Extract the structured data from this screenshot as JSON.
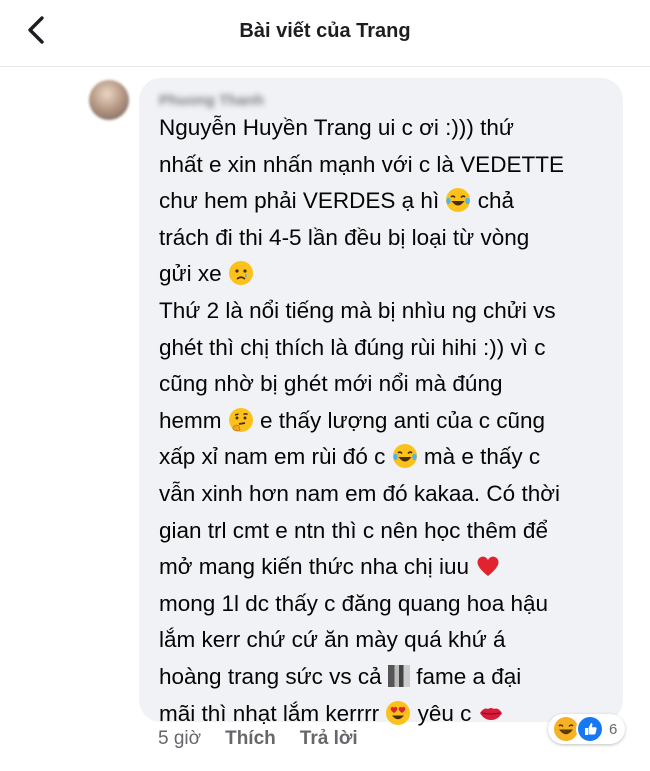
{
  "header": {
    "title": "Bài viết của Trang",
    "back_icon": "chevron-left-icon"
  },
  "comment": {
    "author": "Phuong Thanh",
    "lines": [
      {
        "text": "Nguyễn Huyền Trang ui c ơi :))) thứ"
      },
      {
        "text": "nhất e xin nhấn mạnh với c là VEDETTE"
      },
      {
        "text": "chư hem phải VERDES ạ hì ",
        "emoji": "laughing-tears-emoji",
        "after": " chả"
      },
      {
        "text": "trách đi thi 4-5 lần đều bị loại từ vòng"
      },
      {
        "text": "gửi xe ",
        "emoji": "crying-face-emoji",
        "after": ""
      },
      {
        "text": "Thứ 2 là nổi tiếng mà bị nhìu ng chửi vs"
      },
      {
        "text": "ghét thì chị thích là đúng rùi hihi :)) vì c"
      },
      {
        "text": "cũng nhờ bị ghét mới nổi mà đúng"
      },
      {
        "text": "hemm ",
        "emoji": "thinking-face-emoji",
        "after": " e thấy lượng anti của c cũng"
      },
      {
        "text": "xấp xỉ nam em rùi đó c ",
        "emoji": "laughing-tears-emoji",
        "after": " mà e thấy c"
      },
      {
        "text": "vẫn xinh hơn nam em đó kakaa. Có thời"
      },
      {
        "text": "gian trl cmt e ntn thì c nên học thêm để"
      },
      {
        "text": "mở mang kiến thức nha chị iuu ",
        "emoji": "red-heart-emoji",
        "after": ""
      },
      {
        "text": "mong 1l dc thấy c  đăng quang hoa hậu"
      },
      {
        "text": "lắm kerr chứ cứ ăn mày quá khứ á"
      },
      {
        "text": "hoàng trang sức vs cả ",
        "emoji": "pixelated-block",
        "after": " fame a đại"
      },
      {
        "text": "mãi thì nhạt lắm kerrrr ",
        "emoji": "heart-eyes-emoji",
        "after": " yêu c ",
        "emoji2": "kiss-lips-emoji"
      }
    ]
  },
  "actions": {
    "time": "5 giờ",
    "like_label": "Thích",
    "reply_label": "Trả lời"
  },
  "reactions": {
    "icons": [
      "haha-reaction-icon",
      "like-reaction-icon"
    ],
    "count": "6"
  },
  "colors": {
    "bubble": "#f0f2f5",
    "secondary_text": "#65676b",
    "like_blue": "#1877f2"
  }
}
